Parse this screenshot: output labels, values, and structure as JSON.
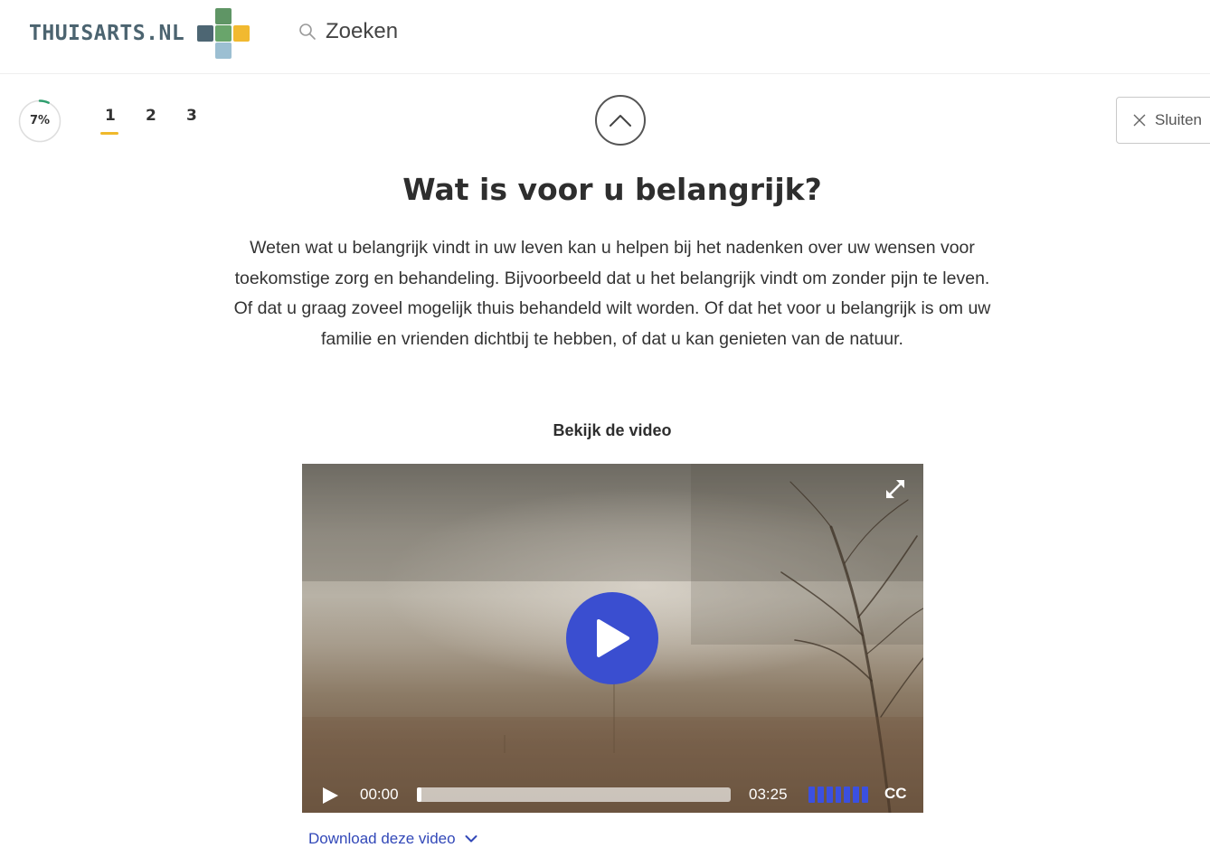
{
  "header": {
    "logo_text": "THUISARTS.NL",
    "search_label": "Zoeken"
  },
  "progress": {
    "percent_label": "7%",
    "value": 0.07
  },
  "steps": [
    {
      "label": "1",
      "active": true
    },
    {
      "label": "2",
      "active": false
    },
    {
      "label": "3",
      "active": false
    }
  ],
  "close_label": "Sluiten",
  "content": {
    "title": "Wat is voor u belangrijk?",
    "intro": "Weten wat u belangrijk vindt in uw leven kan u helpen bij het nadenken over uw wensen voor toekomstige zorg en behandeling. Bijvoorbeeld dat u het belangrijk vindt om zonder pijn te leven. Of dat u graag zoveel mogelijk thuis behandeld wilt worden. Of dat het voor u belangrijk is om uw familie en vrienden dichtbij te hebben, of dat u kan genieten van de natuur.",
    "video_heading": "Bekijk de video"
  },
  "video": {
    "current_time": "00:00",
    "total_time": "03:25",
    "cc_label": "CC",
    "progress": 0,
    "volume": 1.0
  },
  "download_label": "Download deze video",
  "colors": {
    "accent_blue": "#3a4ed0",
    "step_underline": "#f0b92b",
    "logo_text": "#4c6470",
    "progress_ring": "#2f9e6e"
  },
  "icons": {
    "search": "search-icon",
    "up": "chevron-up-icon",
    "close": "close-icon",
    "play": "play-icon",
    "expand": "fullscreen-icon",
    "download": "chevron-down-icon"
  }
}
